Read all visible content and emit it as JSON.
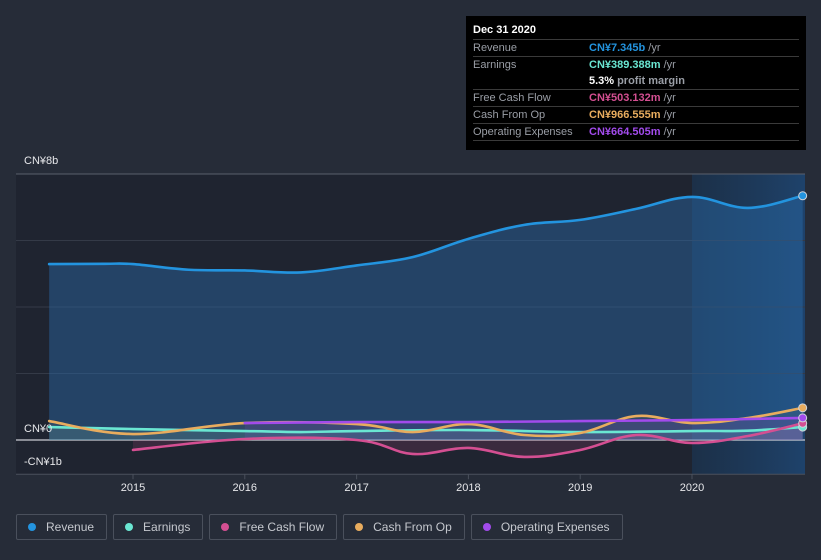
{
  "tooltip": {
    "date": "Dec 31 2020",
    "rows": [
      {
        "label": "Revenue",
        "value": "CN¥7.345b",
        "unit": "/yr",
        "color": "#2394df"
      },
      {
        "label": "Earnings",
        "value": "CN¥389.388m",
        "unit": "/yr",
        "color": "#6ae6d2"
      },
      {
        "label": "",
        "value": "5.3%",
        "unit": "profit margin",
        "color": "#ffffff"
      },
      {
        "label": "Free Cash Flow",
        "value": "CN¥503.132m",
        "unit": "/yr",
        "color": "#d44f92"
      },
      {
        "label": "Cash From Op",
        "value": "CN¥966.555m",
        "unit": "/yr",
        "color": "#e8ac5e"
      },
      {
        "label": "Operating Expenses",
        "value": "CN¥664.505m",
        "unit": "/yr",
        "color": "#a24bec"
      }
    ]
  },
  "legend": [
    {
      "label": "Revenue",
      "color": "#2394df"
    },
    {
      "label": "Earnings",
      "color": "#6ae6d2"
    },
    {
      "label": "Free Cash Flow",
      "color": "#d44f92"
    },
    {
      "label": "Cash From Op",
      "color": "#e8ac5e"
    },
    {
      "label": "Operating Expenses",
      "color": "#a24bec"
    }
  ],
  "chart_data": {
    "type": "line",
    "title": "",
    "xlabel": "",
    "ylabel": "",
    "y_tick_labels": [
      "CN¥8b",
      "CN¥0",
      "-CN¥1b"
    ],
    "y_ticks": [
      8,
      0,
      -1
    ],
    "x_tick_labels": [
      "2015",
      "2016",
      "2017",
      "2018",
      "2019",
      "2020"
    ],
    "x_ticks": [
      2015,
      2016,
      2017,
      2018,
      2019,
      2020
    ],
    "xlim": [
      2013.94,
      2021.0
    ],
    "ylim": [
      -1,
      8
    ],
    "gridlines": [
      8,
      6,
      4,
      2,
      0
    ],
    "highlight_range": [
      2020.0,
      2021.0
    ],
    "units": "CN¥ billions",
    "series": [
      {
        "name": "Revenue",
        "color": "#2394df",
        "x": [
          2014.25,
          2014.75,
          2015.0,
          2015.5,
          2016.0,
          2016.5,
          2017.0,
          2017.5,
          2018.0,
          2018.5,
          2019.0,
          2019.5,
          2020.0,
          2020.5,
          2020.99
        ],
        "values": [
          5.29,
          5.3,
          5.29,
          5.12,
          5.1,
          5.04,
          5.25,
          5.5,
          6.05,
          6.47,
          6.62,
          6.95,
          7.31,
          6.98,
          7.345
        ]
      },
      {
        "name": "Earnings",
        "color": "#6ae6d2",
        "x": [
          2014.25,
          2015.0,
          2016.0,
          2016.5,
          2017.0,
          2018.0,
          2019.0,
          2020.0,
          2020.5,
          2020.99
        ],
        "values": [
          0.39,
          0.33,
          0.27,
          0.24,
          0.27,
          0.3,
          0.24,
          0.27,
          0.28,
          0.389
        ]
      },
      {
        "name": "Free Cash Flow",
        "color": "#d44f92",
        "x": [
          2015.0,
          2016.0,
          2017.0,
          2017.5,
          2018.0,
          2018.5,
          2019.0,
          2019.5,
          2020.0,
          2020.5,
          2020.99
        ],
        "values": [
          -0.3,
          0.03,
          0.0,
          -0.42,
          -0.24,
          -0.51,
          -0.3,
          0.15,
          -0.09,
          0.12,
          0.503
        ]
      },
      {
        "name": "Cash From Op",
        "color": "#e8ac5e",
        "x": [
          2014.25,
          2015.0,
          2016.0,
          2017.0,
          2017.5,
          2018.0,
          2018.5,
          2019.0,
          2019.5,
          2020.0,
          2020.5,
          2020.99
        ],
        "values": [
          0.57,
          0.18,
          0.51,
          0.48,
          0.24,
          0.48,
          0.15,
          0.21,
          0.72,
          0.51,
          0.66,
          0.967
        ]
      },
      {
        "name": "Operating Expenses",
        "color": "#a24bec",
        "x": [
          2016.0,
          2017.0,
          2018.0,
          2019.0,
          2020.0,
          2020.99
        ],
        "values": [
          0.51,
          0.54,
          0.54,
          0.57,
          0.6,
          0.665
        ]
      }
    ]
  }
}
